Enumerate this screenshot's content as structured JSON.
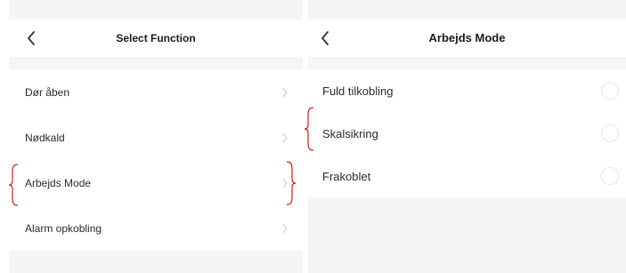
{
  "left_screen": {
    "title": "Select Function",
    "items": [
      {
        "label": "Dør åben"
      },
      {
        "label": "Nødkald"
      },
      {
        "label": "Arbejds Mode"
      },
      {
        "label": "Alarm opkobling"
      }
    ]
  },
  "right_screen": {
    "title": "Arbejds Mode",
    "options": [
      {
        "label": "Fuld tilkobling",
        "selected": false
      },
      {
        "label": "Skalsikring",
        "selected": false
      },
      {
        "label": "Frakoblet",
        "selected": false
      }
    ]
  },
  "annotation": {
    "brace_color": "#cc1f1f"
  },
  "icons": {
    "back": "chevron-left-icon",
    "row_arrow": "chevron-right-icon",
    "option": "radio-circle-icon"
  }
}
